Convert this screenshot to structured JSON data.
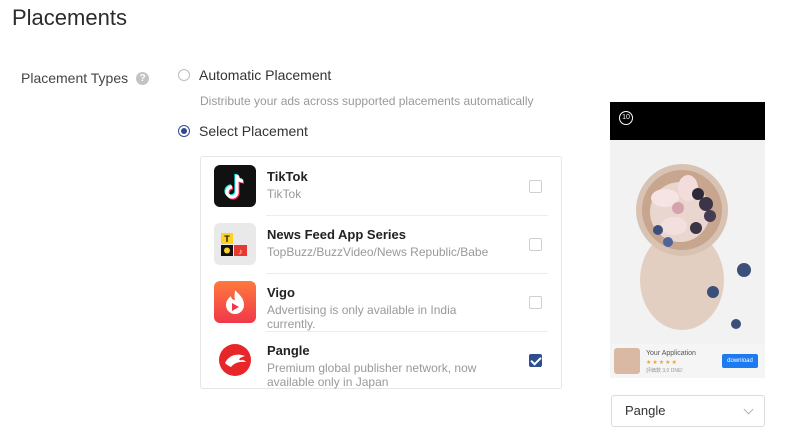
{
  "page": {
    "title": "Placements"
  },
  "placement_types": {
    "label": "Placement Types",
    "help_glyph": "?",
    "options": [
      {
        "label": "Automatic Placement",
        "description": "Distribute your ads across supported placements automatically",
        "selected": false
      },
      {
        "label": "Select Placement",
        "selected": true
      }
    ]
  },
  "placements": [
    {
      "name": "TikTok",
      "description": "TikTok",
      "icon": "tiktok-icon",
      "checked": false
    },
    {
      "name": "News Feed App Series",
      "description": "TopBuzz/BuzzVideo/News Republic/Babe",
      "icon": "news-feed-icon",
      "checked": false
    },
    {
      "name": "Vigo",
      "description": "Advertising is only available in India currently.",
      "icon": "vigo-icon",
      "checked": false
    },
    {
      "name": "Pangle",
      "description": "Premium global publisher network, now available only in Japan",
      "icon": "pangle-icon",
      "checked": true
    }
  ],
  "preview": {
    "timer": "10",
    "ad_title": "Your Application",
    "ad_stars": "★★★★★",
    "ad_meta": "評価数 3,0 DNE!",
    "ad_button": "download"
  },
  "preview_select": {
    "value": "Pangle"
  },
  "colors": {
    "accent": "#2d4f8e",
    "download_button": "#1e7af0"
  }
}
